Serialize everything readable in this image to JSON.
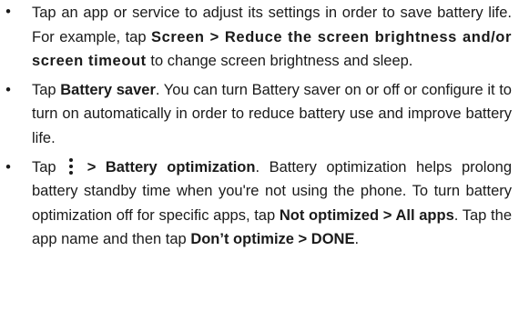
{
  "bullets": {
    "symbol": "•"
  },
  "items": [
    {
      "seg1": "Tap an app or service to adjust its settings in order to save battery life. For example, tap ",
      "bold1": "Screen > Reduce the screen brightness and/or screen timeout",
      "seg2": " to change screen brightness and sleep."
    },
    {
      "seg1": "Tap ",
      "bold1": "Battery saver",
      "seg2": ". You can turn Battery saver on or off or configure it to turn on automatically in order to reduce battery use and improve battery life."
    },
    {
      "seg1": "Tap ",
      "icon": "more-options-icon",
      "bold1": " > Battery optimization",
      "seg2": ". Battery optimization helps prolong battery standby time when you're not using the phone. To turn battery optimization off for specific apps, tap ",
      "bold2": "Not optimized > All apps",
      "seg3": ". Tap the app name and then tap ",
      "bold3": "Don’t optimize > DONE",
      "seg4": "."
    }
  ]
}
